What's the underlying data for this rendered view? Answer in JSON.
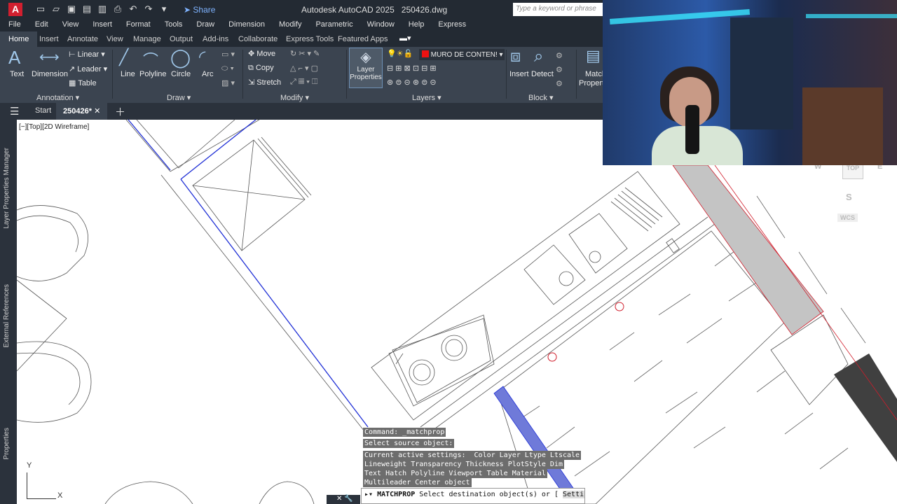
{
  "app": {
    "logo": "A",
    "title": "Autodesk AutoCAD 2025",
    "file": "250426.dwg",
    "share": "Share",
    "search_placeholder": "Type a keyword or phrase"
  },
  "menu": [
    "File",
    "Edit",
    "View",
    "Insert",
    "Format",
    "Tools",
    "Draw",
    "Dimension",
    "Modify",
    "Parametric",
    "Window",
    "Help",
    "Express"
  ],
  "ribbon_tabs": [
    "Home",
    "Insert",
    "Annotate",
    "View",
    "Manage",
    "Output",
    "Add-ins",
    "Collaborate",
    "Express Tools",
    "Featured Apps"
  ],
  "ribbon": {
    "annotation": {
      "text": "Text",
      "dimension": "Dimension",
      "linear": "Linear",
      "leader": "Leader",
      "table": "Table",
      "label": "Annotation"
    },
    "draw": {
      "line": "Line",
      "polyline": "Polyline",
      "circle": "Circle",
      "arc": "Arc",
      "label": "Draw"
    },
    "modify": {
      "move": "Move",
      "copy": "Copy",
      "stretch": "Stretch",
      "label": "Modify"
    },
    "layers": {
      "layer_properties_1": "Layer",
      "layer_properties_2": "Properties",
      "current_layer": "MURO DE CONTEN!",
      "label": "Layers"
    },
    "block": {
      "insert": "Insert",
      "detect": "Detect",
      "label": "Block"
    },
    "properties": {
      "match_1": "Match",
      "match_2": "Propert"
    }
  },
  "file_tabs": {
    "start": "Start",
    "active": "250426*"
  },
  "side_palettes": [
    "Layer Properties Manager",
    "External References",
    "Properties"
  ],
  "viewport_label": "[−][Top][2D Wireframe]",
  "viewcube": {
    "top": "TOP",
    "south": "S",
    "wcs": "WCS",
    "west": "W",
    "east": "E"
  },
  "ucs": {
    "x": "X",
    "y": "Y"
  },
  "command_history": [
    "Command: _matchprop",
    "Select source object:",
    "Current active settings:  Color Layer Ltype Ltscale",
    "Lineweight Transparency Thickness PlotStyle Dim",
    "Text Hatch Polyline Viewport Table Material",
    "Multileader Center object"
  ],
  "command_prompt": {
    "name": "MATCHPROP",
    "text": "Select destination object(s) or [",
    "text2": "Settings]:"
  },
  "colors": {
    "titlebar": "#232a33",
    "ribbon": "#3b4450",
    "accent": "#d21f2f",
    "selection": "#1f2fd6"
  }
}
